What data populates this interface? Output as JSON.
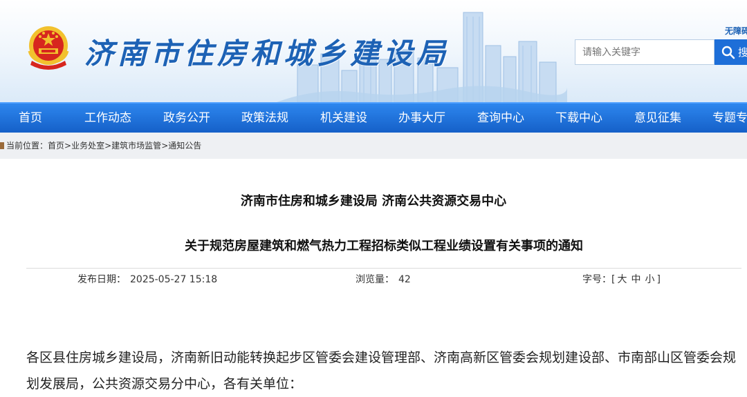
{
  "header": {
    "site_title": "济南市住房和城乡建设局",
    "accessibility_label": "无障碍",
    "search": {
      "placeholder": "请输入关键字",
      "button_label": "搜"
    }
  },
  "nav": {
    "items": [
      {
        "label": "首页"
      },
      {
        "label": "工作动态"
      },
      {
        "label": "政务公开"
      },
      {
        "label": "政策法规"
      },
      {
        "label": "机关建设"
      },
      {
        "label": "办事大厅"
      },
      {
        "label": "查询中心"
      },
      {
        "label": "下载中心"
      },
      {
        "label": "意见征集"
      },
      {
        "label": "专题专"
      }
    ]
  },
  "breadcrumb": {
    "prefix": "当前位置：",
    "items": [
      {
        "label": "首页"
      },
      {
        "label": "业务处室"
      },
      {
        "label": "建筑市场监管"
      },
      {
        "label": "通知公告"
      }
    ],
    "separator": ">"
  },
  "article": {
    "org_line": "济南市住房和城乡建设局 济南公共资源交易中心",
    "title": "关于规范房屋建筑和燃气热力工程招标类似工程业绩设置有关事项的通知",
    "meta": {
      "date_label": "发布日期：",
      "date_value": "2025-05-27 15:18",
      "views_label": "浏览量：",
      "views_value": "42",
      "fontsize_label": "字号：",
      "fontsize_open": "[",
      "fontsize_large": "大",
      "fontsize_medium": "中",
      "fontsize_small": "小",
      "fontsize_close": "]"
    },
    "paragraph": "各区县住房城乡建设局，济南新旧动能转换起步区管委会建设管理部、济南高新区管委会规划建设部、市南部山区管委会规划发展局，公共资源交易分中心，各有关单位："
  },
  "colors": {
    "brand_blue": "#1d62b5",
    "nav_blue": "#1d6ed8",
    "emblem_red": "#d7261e",
    "emblem_gold": "#f2c12e"
  }
}
